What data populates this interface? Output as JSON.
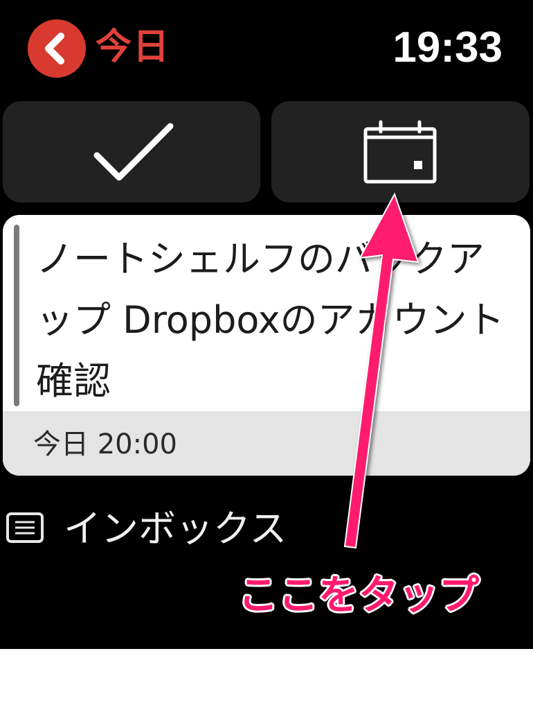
{
  "header": {
    "back_label": "今日",
    "time": "19:33"
  },
  "actions": {
    "complete_icon": "checkmark-icon",
    "schedule_icon": "calendar-icon"
  },
  "task": {
    "title": "ノートシェルフのバックアップ Dropboxのアカウント確認",
    "due": "今日 20:00"
  },
  "list": {
    "icon": "inbox-tray-icon",
    "label": "インボックス"
  },
  "annotation": {
    "text": "ここをタップ",
    "color": "#ff1a6e"
  },
  "colors": {
    "accent": "#d83a2f",
    "background": "#000000",
    "card": "#ffffff"
  }
}
